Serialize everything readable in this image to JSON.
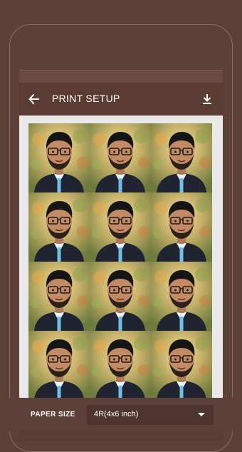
{
  "app_bar": {
    "title": "PRINT SETUP",
    "back_icon": "arrow-back-icon",
    "download_icon": "download-icon"
  },
  "preview": {
    "rows": 4,
    "columns": 3
  },
  "paper_size": {
    "label": "PAPER SIZE",
    "selected": "4R(4x6 inch)"
  },
  "colors": {
    "background": "#5d4037",
    "app_bar": "#5b3c32",
    "preview_bg": "#e9e9e9",
    "select_bg": "#4e342e"
  }
}
